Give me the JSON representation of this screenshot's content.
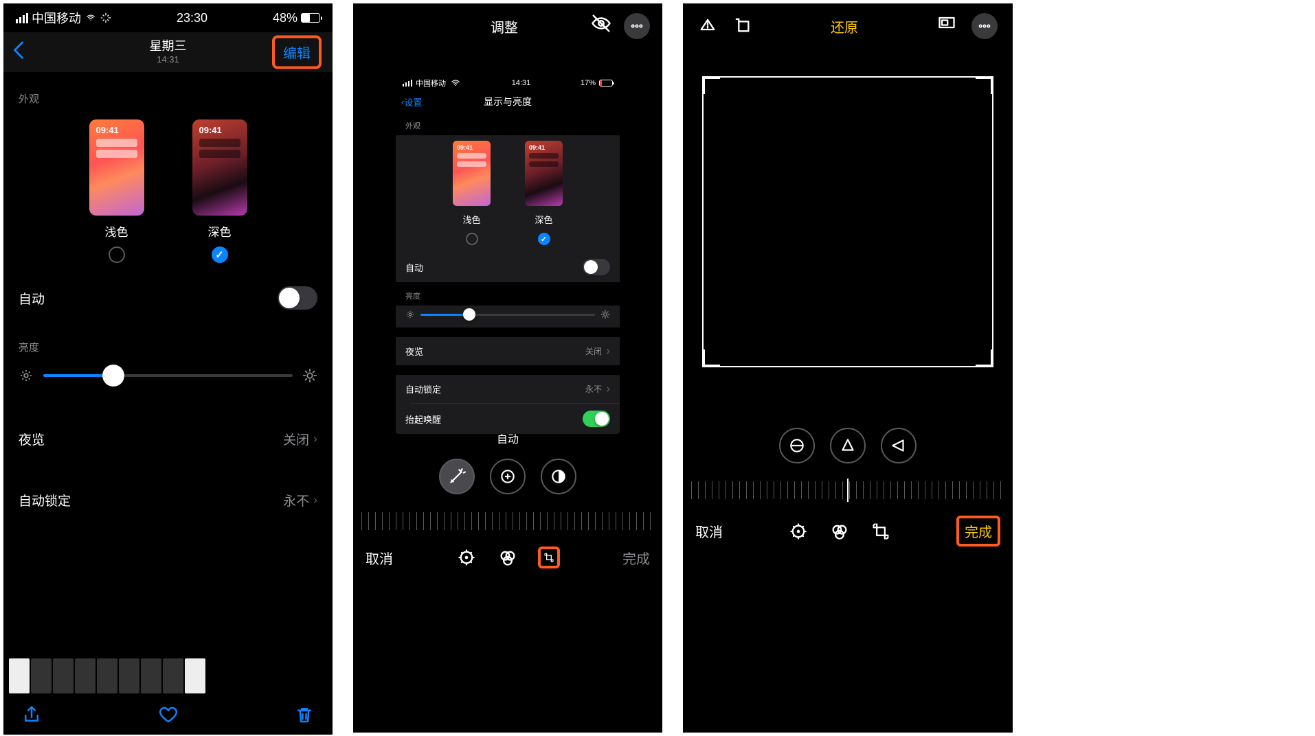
{
  "p1": {
    "status": {
      "carrier": "中国移动",
      "time": "23:30",
      "batt": "48%",
      "batt_fill": 48
    },
    "nav": {
      "title": "星期三",
      "sub": "14:31",
      "edit": "编辑"
    },
    "appearance_label": "外观",
    "light": "浅色",
    "dark": "深色",
    "thumb_time": "09:41",
    "auto": "自动",
    "brightness_label": "亮度",
    "brightness_pct": 28,
    "night": "夜览",
    "night_val": "关闭",
    "autolock": "自动锁定",
    "autolock_val": "永不"
  },
  "p2": {
    "top": {
      "title": "调整"
    },
    "inner": {
      "status": {
        "carrier": "中国移动",
        "time": "14:31",
        "batt": "17%"
      },
      "back": "设置",
      "title": "显示与亮度",
      "appearance_label": "外观",
      "light": "浅色",
      "dark": "深色",
      "thumb_time": "09:41",
      "auto": "自动",
      "brightness_label": "亮度",
      "brightness_pct": 28,
      "night": "夜览",
      "night_val": "关闭",
      "autolock": "自动锁定",
      "autolock_val": "永不",
      "raise": "抬起唤醒"
    },
    "tooltip": "自动",
    "bottom": {
      "cancel": "取消",
      "done": "完成"
    }
  },
  "p3": {
    "top": {
      "revert": "还原"
    },
    "bottom": {
      "cancel": "取消",
      "done": "完成"
    }
  }
}
